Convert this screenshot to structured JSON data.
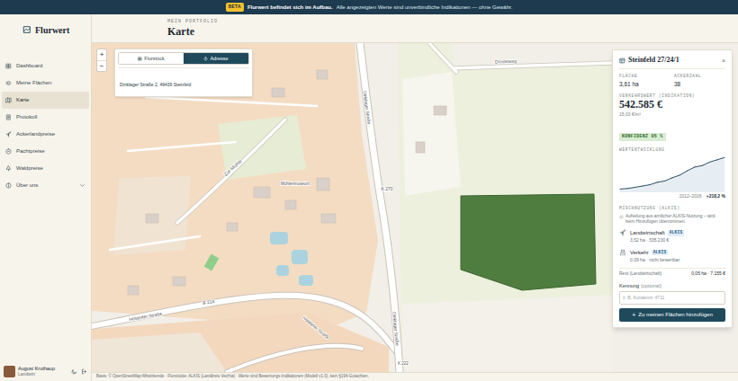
{
  "banner": {
    "badge": "BETA",
    "strong": "Flurwert befindet sich im Aufbau.",
    "text": "Alle angezeigten Werte sind unverbindliche Indikationen — ohne Gewähr."
  },
  "brand": "Flurwert",
  "sidebar": {
    "items": [
      {
        "label": "Dashboard",
        "selected": false
      },
      {
        "label": "Meine Flächen",
        "selected": false
      },
      {
        "label": "Karte",
        "selected": true
      },
      {
        "label": "Protokoll",
        "selected": false
      },
      {
        "label": "Ackerlandpreise",
        "selected": false
      },
      {
        "label": "Pachtpreise",
        "selected": false
      },
      {
        "label": "Waldpreise",
        "selected": false
      },
      {
        "label": "Über uns",
        "selected": false,
        "expanded": false
      }
    ]
  },
  "user": {
    "name": "August Kruthaup",
    "role": "Landwirt"
  },
  "header": {
    "eyebrow": "MEIN PORTFOLIO",
    "title": "Karte"
  },
  "map": {
    "zoom": [
      "+",
      "−"
    ],
    "search": {
      "tabs": [
        {
          "label": "Flurstück",
          "selected": false
        },
        {
          "label": "Adresse",
          "selected": true
        }
      ],
      "value": "Dinklager Straße 2, 49439 Steinfeld"
    },
    "labels": [
      "Zur Mühle",
      "Dinklager Straße",
      "K 270",
      "Mühlenmuseum",
      "Dinklager Straße",
      "B 214",
      "Holdorfer Straße",
      "Holdorfer Straße",
      "K 222",
      "Drosteweg"
    ],
    "attribution": "Basis: © OpenStreetMap-Mitwirkende · Flurstücke: ALKIS (Landkreis Vechta) · Werte sind Bewertungs-Indikationen (Modell v1.0), kein §194-Gutachten."
  },
  "parcel": {
    "title": "Steinfeld 27/24/1",
    "close": "×",
    "stats": [
      {
        "label": "FLÄCHE",
        "value": "3,61 ha"
      },
      {
        "label": "ACKERZAHL",
        "value": "38"
      }
    ],
    "value_label": "VERKEHRSWERT (INDIKATION)",
    "value": "542.585 €",
    "per_m2": "15,03 €/m²",
    "confidence": "KONFIDENZ 95 %",
    "chart": {
      "title": "WERTENTWICKLUNG",
      "values": [
        100,
        104,
        112,
        121,
        130,
        147,
        156,
        178,
        196,
        226,
        252,
        262,
        286,
        302,
        318
      ],
      "range": "2012–2026 ·",
      "change": "+218,2 %"
    },
    "mix": {
      "title": "MISCHNUTZUNG (ALKIS)",
      "note": "Aufteilung aus amtlicher ALKIS-Nutzung – wird beim Hinzufügen übernommen.",
      "rows": [
        {
          "label": "Landwirtschaft",
          "badge": "ALKIS",
          "detail": "3,52 ha · 535.230 €"
        },
        {
          "label": "Verkehr",
          "badge": "ALKIS",
          "detail": "0,09 ha · nicht bewertbar"
        }
      ],
      "rest": {
        "label": "Rest (Landwirtschaft)",
        "value": "0,05 ha · 7.155 €"
      }
    },
    "kennung": {
      "label": "Kennung",
      "hint": "(optional)",
      "placeholder": "z. B. Kundennr. 4711"
    },
    "button": {
      "icon": "+",
      "label": "Zu meinen Flächen hinzufügen"
    }
  }
}
